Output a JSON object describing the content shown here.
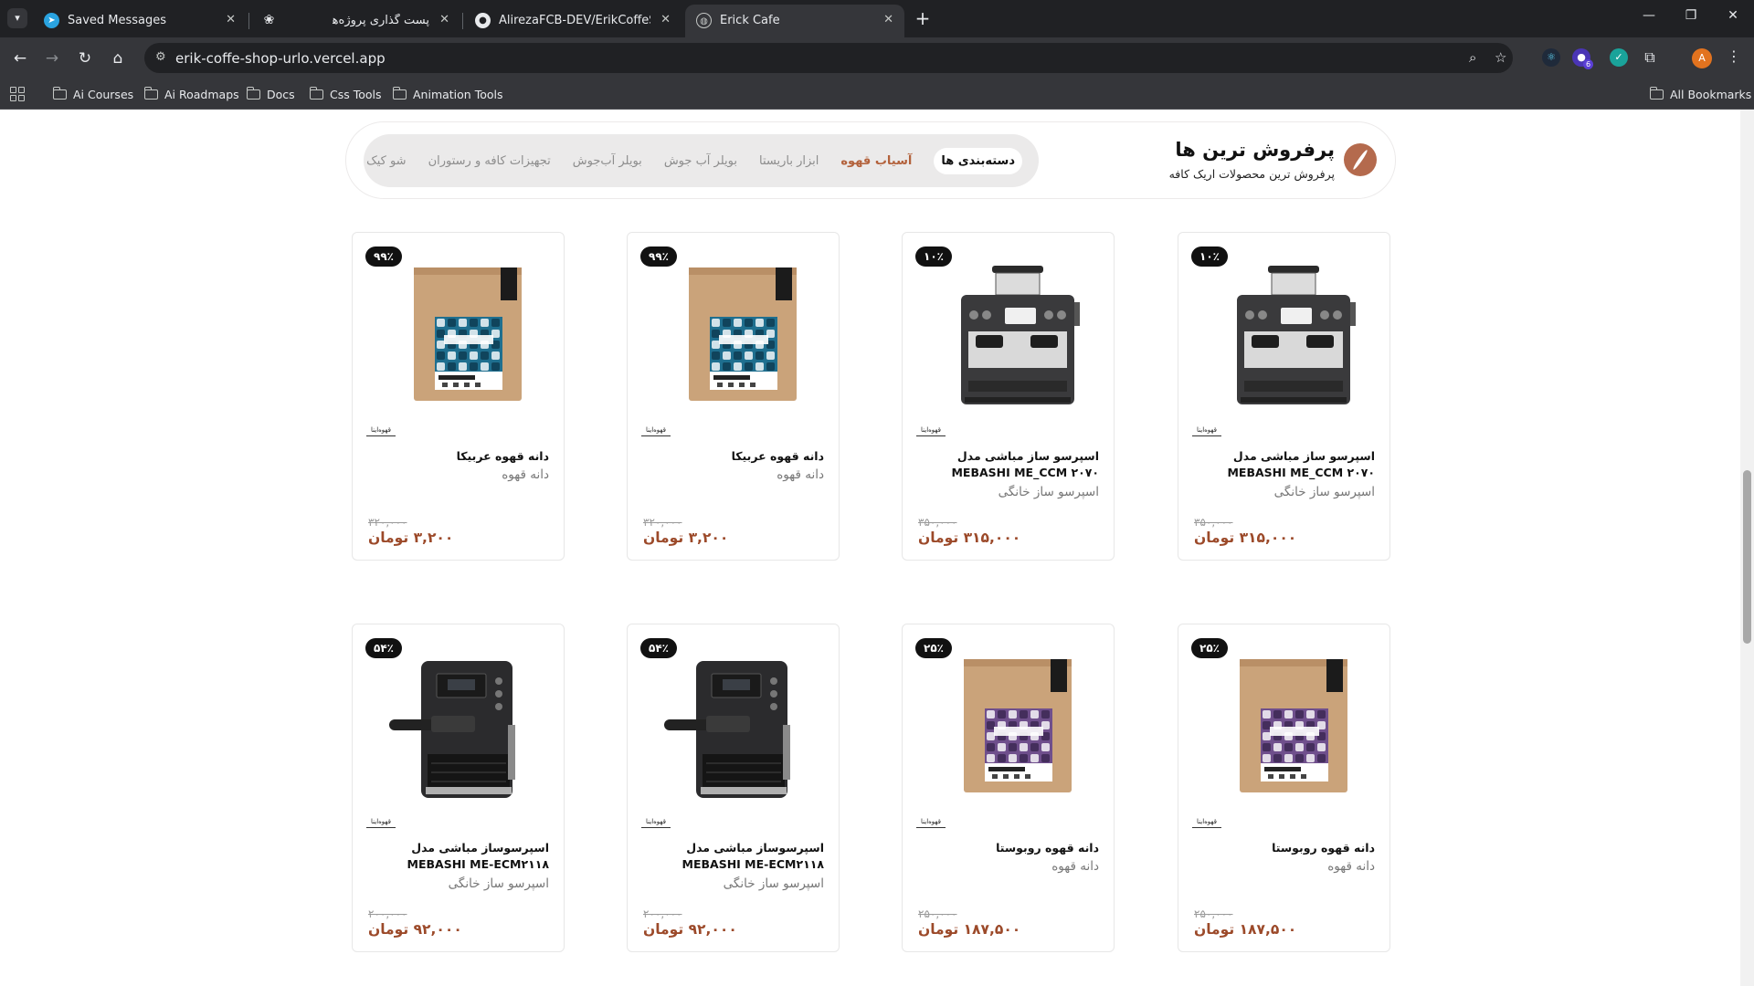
{
  "browser": {
    "tabs": [
      {
        "title": "Saved Messages",
        "icon": "telegram-icon",
        "active": false
      },
      {
        "title": "",
        "icon": "openai-icon",
        "active": false
      },
      {
        "title": "پست گذاری پروژه‌ها",
        "icon": "none",
        "active": false
      },
      {
        "title": "AlirezaFCB-DEV/ErikCoffeShop",
        "icon": "github-icon",
        "active": false
      },
      {
        "title": "Erick Cafe",
        "icon": "globe-icon",
        "active": true
      }
    ],
    "url": "erik-coffe-shop-urlo.vercel.app",
    "profile_initial": "A",
    "extension_badge": "6",
    "bookmarks": [
      "Ai Courses",
      "Ai Roadmaps",
      "Docs",
      "Css Tools",
      "Animation Tools"
    ],
    "all_bookmarks": "All Bookmarks"
  },
  "section": {
    "title": "پرفروش ترین ها",
    "subtitle": "پرفروش ترین محصولات اریک کافه",
    "categories": [
      {
        "label": "دسته‌بندی ها",
        "state": "active"
      },
      {
        "label": "آسیاب قهوه",
        "state": "accent"
      },
      {
        "label": "ابزار باریستا",
        "state": "normal"
      },
      {
        "label": "بویلر آب جوش",
        "state": "normal"
      },
      {
        "label": "بویلر آب‌جوش",
        "state": "normal"
      },
      {
        "label": "تجهیزات کافه و رستوران",
        "state": "normal"
      },
      {
        "label": "شو کیک",
        "state": "normal"
      }
    ]
  },
  "products": [
    {
      "name": "اسپرسو ساز مباشی مدل MEBASHI ME_CCM ۲۰۷۰",
      "category": "اسپرسو ساز خانگی",
      "discount": "۱۰٪",
      "old_price": "۳۵۰,۰۰۰",
      "price": "۳۱۵,۰۰۰ تومان",
      "kind": "machine-large",
      "brand": "قهوه‌اینا"
    },
    {
      "name": "اسپرسو ساز مباشی مدل MEBASHI ME_CCM ۲۰۷۰",
      "category": "اسپرسو ساز خانگی",
      "discount": "۱۰٪",
      "old_price": "۳۵۰,۰۰۰",
      "price": "۳۱۵,۰۰۰ تومان",
      "kind": "machine-large",
      "brand": "قهوه‌اینا"
    },
    {
      "name": "دانه قهوه عربیکا",
      "category": "دانه قهوه",
      "discount": "۹۹٪",
      "old_price": "۳۲۰,۰۰۰",
      "price": "۳,۲۰۰ تومان",
      "kind": "bag-blue",
      "brand": "قهوه‌اینا"
    },
    {
      "name": "دانه قهوه عربیکا",
      "category": "دانه قهوه",
      "discount": "۹۹٪",
      "old_price": "۳۲۰,۰۰۰",
      "price": "۳,۲۰۰ تومان",
      "kind": "bag-blue",
      "brand": "قهوه‌اینا"
    },
    {
      "name": "دانه قهوه روبوستا",
      "category": "دانه قهوه",
      "discount": "۲۵٪",
      "old_price": "۲۵۰,۰۰۰",
      "price": "۱۸۷,۵۰۰ تومان",
      "kind": "bag-purple",
      "brand": "قهوه‌اینا"
    },
    {
      "name": "دانه قهوه روبوستا",
      "category": "دانه قهوه",
      "discount": "۲۵٪",
      "old_price": "۲۵۰,۰۰۰",
      "price": "۱۸۷,۵۰۰ تومان",
      "kind": "bag-purple",
      "brand": "قهوه‌اینا"
    },
    {
      "name": "اسپرسوساز مباشی مدل MEBASHI ME-ECM۲۱۱۸",
      "category": "اسپرسو ساز خانگی",
      "discount": "۵۴٪",
      "old_price": "۲۰۰,۰۰۰",
      "price": "۹۲,۰۰۰ تومان",
      "kind": "machine-small",
      "brand": "قهوه‌اینا"
    },
    {
      "name": "اسپرسوساز مباشی مدل MEBASHI ME-ECM۲۱۱۸",
      "category": "اسپرسو ساز خانگی",
      "discount": "۵۴٪",
      "old_price": "۲۰۰,۰۰۰",
      "price": "۹۲,۰۰۰ تومان",
      "kind": "machine-small",
      "brand": "قهوه‌اینا"
    }
  ],
  "colors": {
    "accent": "#b3623c",
    "price": "#9c4a2a",
    "badge_bg": "#111111"
  }
}
